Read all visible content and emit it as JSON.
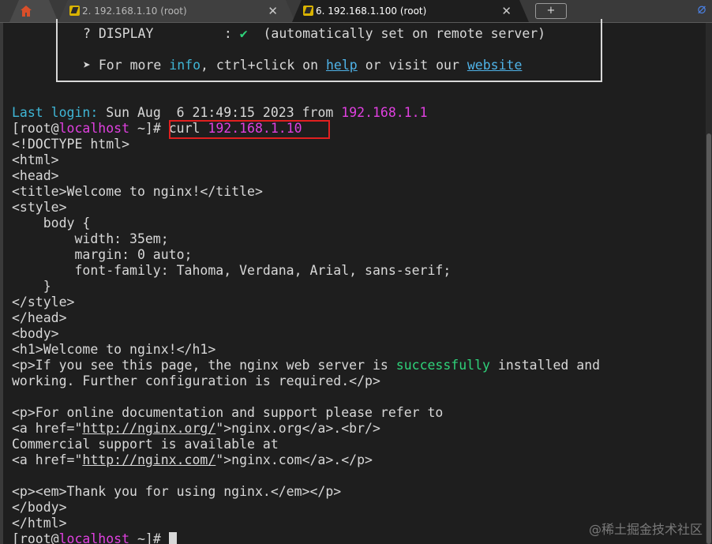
{
  "tabs": {
    "tab1_label": "2. 192.168.1.10 (root)",
    "tab2_label": "6. 192.168.1.100 (root)",
    "close_glyph": "✕",
    "new_tab_glyph": "+"
  },
  "banner": {
    "display_label": "? DISPLAY",
    "display_sep": ":",
    "display_check": "✔",
    "display_note": "(automatically set on remote server)",
    "more_bullet": "➤",
    "more_prefix": "For more",
    "info_word": "info",
    "more_mid": ", ctrl+click on",
    "help_word": "help",
    "more_mid2": "or visit our",
    "website_word": "website"
  },
  "login": {
    "label": "Last login:",
    "datetime": "Sun Aug  6 21:49:15 2023",
    "from_word": "from",
    "ip": "192.168.1.1"
  },
  "prompt": {
    "open": "[root@",
    "host": "localhost",
    "close": " ~]#",
    "command": "curl",
    "target": "192.168.1.10"
  },
  "output": {
    "l1": "<!DOCTYPE html>",
    "l2": "<html>",
    "l3": "<head>",
    "l4": "<title>Welcome to nginx!</title>",
    "l5": "<style>",
    "l6": "    body {",
    "l7": "        width: 35em;",
    "l8": "        margin: 0 auto;",
    "l9": "        font-family: Tahoma, Verdana, Arial, sans-serif;",
    "l10": "    }",
    "l11": "</style>",
    "l12": "</head>",
    "l13": "<body>",
    "l14": "<h1>Welcome to nginx!</h1>",
    "l15a": "<p>If you see this page, the nginx web server is ",
    "l15b": "successfully",
    "l15c": " installed and",
    "l16": "working. Further configuration is required.</p>",
    "l18": "<p>For online documentation and support please refer to",
    "l19a": "<a href=\"",
    "l19b": "http://nginx.org/",
    "l19c": "\">nginx.org</a>.<br/>",
    "l20": "Commercial support is available at",
    "l21a": "<a href=\"",
    "l21b": "http://nginx.com/",
    "l21c": "\">nginx.com</a>.</p>",
    "l23": "<p><em>Thank you for using nginx.</em></p>",
    "l24": "</body>",
    "l25": "</html>"
  },
  "watermark": "@稀土掘金技术社区"
}
